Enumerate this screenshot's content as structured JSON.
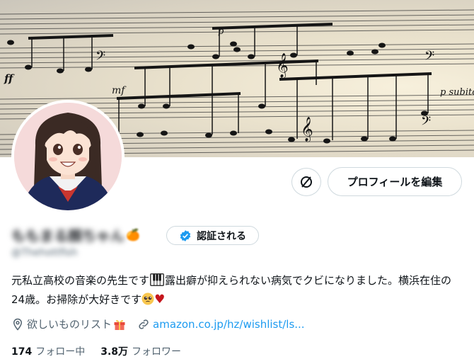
{
  "profile": {
    "display_name": "ももまる顔ちゃん",
    "name_emoji": "🍊",
    "handle": "@Thehottfish",
    "verify_label": "認証される",
    "edit_label": "プロフィールを編集",
    "bio_part1": "元私立高校の音楽の先生です",
    "bio_part2": "露出癖が抑えられない病気でクビになりました。横浜在住の24歳。お掃除が大好きです",
    "bio_heart": "♥",
    "wishlist_label": "欲しいものリスト",
    "link_text": "amazon.co.jp/hz/wishlist/ls...",
    "following_count": "174",
    "following_label": "フォロー中",
    "followers_count": "3.8万",
    "followers_label": "フォロワー"
  },
  "banner_text": {
    "p": "p",
    "mf": "mf",
    "ff": "ff",
    "p_subito": "p subito"
  },
  "colors": {
    "link": "#1d9bf0",
    "verified": "#1d9bf0",
    "heart": "#c5161d",
    "border": "#cfd9de",
    "secondary_text": "#536471"
  },
  "icons": {
    "circle_button": "no-sign-icon",
    "location": "location-pin-icon",
    "link": "link-icon",
    "verified": "verified-badge-icon",
    "gift": "gift-icon",
    "piano": "piano-keys-icon",
    "face": "pleading-face-emoji"
  }
}
